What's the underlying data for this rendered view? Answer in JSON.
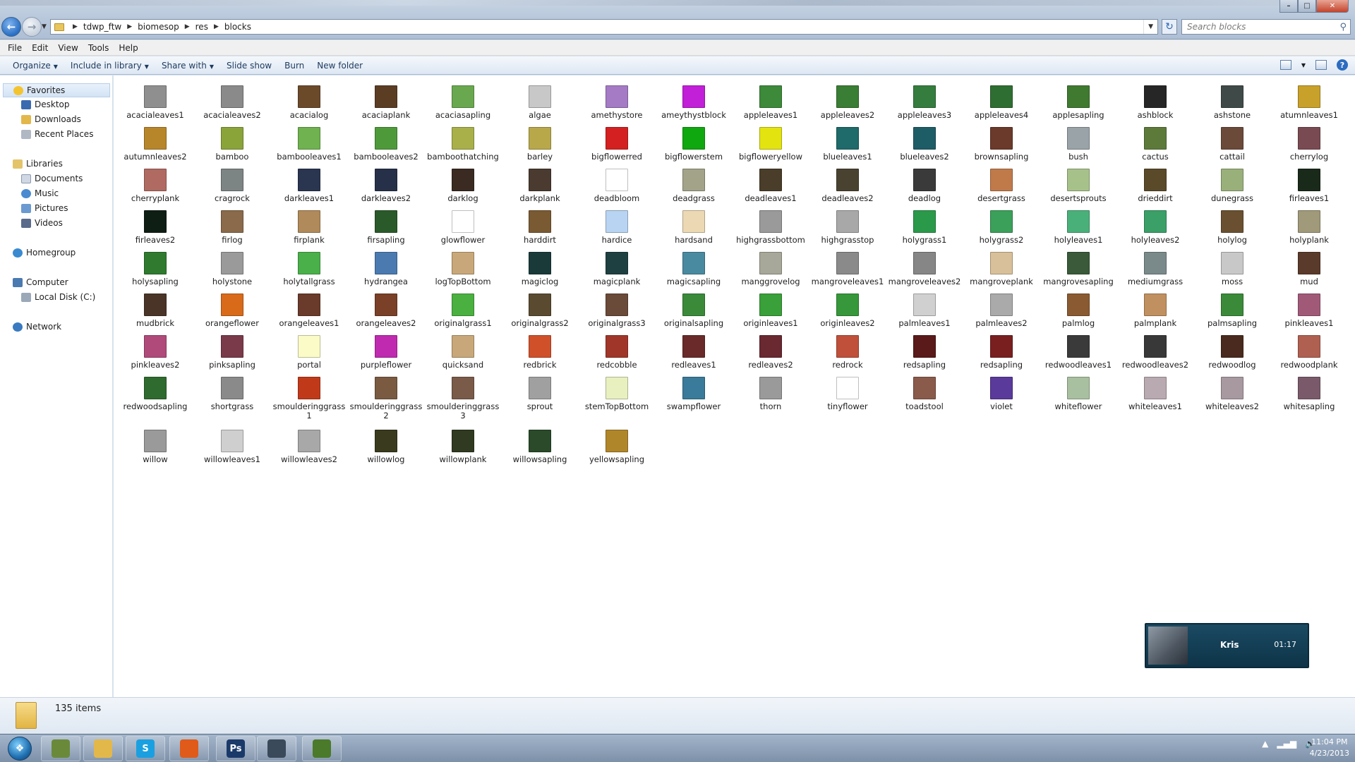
{
  "window": {
    "breadcrumb": [
      "tdwp_ftw",
      "biomesop",
      "res",
      "blocks"
    ],
    "search_placeholder": "Search blocks"
  },
  "menu": [
    "File",
    "Edit",
    "View",
    "Tools",
    "Help"
  ],
  "commands": {
    "organize": "Organize",
    "include": "Include in library",
    "share": "Share with",
    "slideshow": "Slide show",
    "burn": "Burn",
    "newfolder": "New folder"
  },
  "nav": {
    "favorites": "Favorites",
    "desktop": "Desktop",
    "downloads": "Downloads",
    "recent": "Recent Places",
    "libraries": "Libraries",
    "documents": "Documents",
    "music": "Music",
    "pictures": "Pictures",
    "videos": "Videos",
    "homegroup": "Homegroup",
    "computer": "Computer",
    "localdisk": "Local Disk (C:)",
    "network": "Network"
  },
  "files": [
    {
      "name": "acacialeaves1",
      "color": "#8f8f8f"
    },
    {
      "name": "acacialeaves2",
      "color": "#8a8a8a"
    },
    {
      "name": "acacialog",
      "color": "#6b4a2a"
    },
    {
      "name": "acaciaplank",
      "color": "#5b3d24"
    },
    {
      "name": "acaciasapling",
      "color": "#6aa84f"
    },
    {
      "name": "algae",
      "color": "#c8c8c8"
    },
    {
      "name": "amethystore",
      "color": "#a47bc4"
    },
    {
      "name": "ameythystblock",
      "color": "#c21fd8"
    },
    {
      "name": "appleleaves1",
      "color": "#3d8a3a"
    },
    {
      "name": "appleleaves2",
      "color": "#3a7d34"
    },
    {
      "name": "appleleaves3",
      "color": "#357d3e"
    },
    {
      "name": "appleleaves4",
      "color": "#2f6e32"
    },
    {
      "name": "applesapling",
      "color": "#3f7a30"
    },
    {
      "name": "ashblock",
      "color": "#262626"
    },
    {
      "name": "ashstone",
      "color": "#3f4a48"
    },
    {
      "name": "atumnleaves1",
      "color": "#c8a12a"
    },
    {
      "name": "autumnleaves2",
      "color": "#b8862a"
    },
    {
      "name": "bamboo",
      "color": "#8aa43a"
    },
    {
      "name": "bambooleaves1",
      "color": "#6fb24f"
    },
    {
      "name": "bambooleaves2",
      "color": "#4e9a3a"
    },
    {
      "name": "bamboothatching",
      "color": "#a9b04a"
    },
    {
      "name": "barley",
      "color": "#b9a84a"
    },
    {
      "name": "bigflowerred",
      "color": "#d42020"
    },
    {
      "name": "bigflowerstem",
      "color": "#0fa80f"
    },
    {
      "name": "bigfloweryellow",
      "color": "#e3e310"
    },
    {
      "name": "blueleaves1",
      "color": "#1f6a6a"
    },
    {
      "name": "blueleaves2",
      "color": "#1e5d66"
    },
    {
      "name": "brownsapling",
      "color": "#6b3a2a"
    },
    {
      "name": "bush",
      "color": "#9aa3a8"
    },
    {
      "name": "cactus",
      "color": "#5d7a3a"
    },
    {
      "name": "cattail",
      "color": "#6b4a3a"
    },
    {
      "name": "cherrylog",
      "color": "#7a4a52"
    },
    {
      "name": "cherryplank",
      "color": "#b06a62"
    },
    {
      "name": "cragrock",
      "color": "#7c8584"
    },
    {
      "name": "darkleaves1",
      "color": "#2a3550"
    },
    {
      "name": "darkleaves2",
      "color": "#263048"
    },
    {
      "name": "darklog",
      "color": "#3a2a22"
    },
    {
      "name": "darkplank",
      "color": "#4a3a30"
    },
    {
      "name": "deadbloom",
      "color": "#ffffff"
    },
    {
      "name": "deadgrass",
      "color": "#a3a38a"
    },
    {
      "name": "deadleaves1",
      "color": "#4a3e2a"
    },
    {
      "name": "deadleaves2",
      "color": "#4a4230"
    },
    {
      "name": "deadlog",
      "color": "#3a3a3a"
    },
    {
      "name": "desertgrass",
      "color": "#c07a4a"
    },
    {
      "name": "desertsprouts",
      "color": "#a6c28a"
    },
    {
      "name": "drieddirt",
      "color": "#5a4a2a"
    },
    {
      "name": "dunegrass",
      "color": "#9ab07a"
    },
    {
      "name": "firleaves1",
      "color": "#1a2a1a"
    },
    {
      "name": "firleaves2",
      "color": "#0f1e14"
    },
    {
      "name": "firlog",
      "color": "#8a6a4a"
    },
    {
      "name": "firplank",
      "color": "#b08a5a"
    },
    {
      "name": "firsapling",
      "color": "#2a5a2a"
    },
    {
      "name": "glowflower",
      "color": "#ffffff"
    },
    {
      "name": "harddirt",
      "color": "#7a5a32"
    },
    {
      "name": "hardice",
      "color": "#b8d4f2"
    },
    {
      "name": "hardsand",
      "color": "#ecd9b4"
    },
    {
      "name": "highgrassbottom",
      "color": "#9a9a9a"
    },
    {
      "name": "highgrasstop",
      "color": "#a8a8a8"
    },
    {
      "name": "holygrass1",
      "color": "#2a9a4a"
    },
    {
      "name": "holygrass2",
      "color": "#3aa05a"
    },
    {
      "name": "holyleaves1",
      "color": "#4ab07a"
    },
    {
      "name": "holyleaves2",
      "color": "#3aa068"
    },
    {
      "name": "holylog",
      "color": "#6a5030"
    },
    {
      "name": "holyplank",
      "color": "#a09a7a"
    },
    {
      "name": "holysapling",
      "color": "#2f7a2f"
    },
    {
      "name": "holystone",
      "color": "#9a9a9a"
    },
    {
      "name": "holytallgrass",
      "color": "#4ab04a"
    },
    {
      "name": "hydrangea",
      "color": "#4a7ab0"
    },
    {
      "name": "logTopBottom",
      "color": "#c8a87a"
    },
    {
      "name": "magiclog",
      "color": "#1a3a3a"
    },
    {
      "name": "magicplank",
      "color": "#1f4040"
    },
    {
      "name": "magicsapling",
      "color": "#4a8aa0"
    },
    {
      "name": "manggrovelog",
      "color": "#a8a89a"
    },
    {
      "name": "mangroveleaves1",
      "color": "#8a8a8a"
    },
    {
      "name": "mangroveleaves2",
      "color": "#868686"
    },
    {
      "name": "mangroveplank",
      "color": "#d8c09a"
    },
    {
      "name": "mangrovesapling",
      "color": "#3a5a3a"
    },
    {
      "name": "mediumgrass",
      "color": "#7a8a8a"
    },
    {
      "name": "moss",
      "color": "#c8c8c8"
    },
    {
      "name": "mud",
      "color": "#5a3a2a"
    },
    {
      "name": "mudbrick",
      "color": "#4a3428"
    },
    {
      "name": "orangeflower",
      "color": "#d86a1a"
    },
    {
      "name": "orangeleaves1",
      "color": "#6a3a2a"
    },
    {
      "name": "orangeleaves2",
      "color": "#7a4028"
    },
    {
      "name": "originalgrass1",
      "color": "#4ab040"
    },
    {
      "name": "originalgrass2",
      "color": "#5a4a30"
    },
    {
      "name": "originalgrass3",
      "color": "#6a4a38"
    },
    {
      "name": "originalsapling",
      "color": "#3a8a3a"
    },
    {
      "name": "originleaves1",
      "color": "#3aa03a"
    },
    {
      "name": "originleaves2",
      "color": "#36983a"
    },
    {
      "name": "palmleaves1",
      "color": "#d0d0d0"
    },
    {
      "name": "palmleaves2",
      "color": "#aaaaaa"
    },
    {
      "name": "palmlog",
      "color": "#8a5a32"
    },
    {
      "name": "palmplank",
      "color": "#c09060"
    },
    {
      "name": "palmsapling",
      "color": "#3a8a3a"
    },
    {
      "name": "pinkleaves1",
      "color": "#a05a78"
    },
    {
      "name": "pinkleaves2",
      "color": "#b04a7a"
    },
    {
      "name": "pinksapling",
      "color": "#7a3a4a"
    },
    {
      "name": "portal",
      "color": "#fbfbc8"
    },
    {
      "name": "purpleflower",
      "color": "#c02ab0"
    },
    {
      "name": "quicksand",
      "color": "#c8a87a"
    },
    {
      "name": "redbrick",
      "color": "#d0502a"
    },
    {
      "name": "redcobble",
      "color": "#a0362a"
    },
    {
      "name": "redleaves1",
      "color": "#6a2a2a"
    },
    {
      "name": "redleaves2",
      "color": "#6a2830"
    },
    {
      "name": "redrock",
      "color": "#c0503a"
    },
    {
      "name": "redsapling",
      "color": "#5a1a1a"
    },
    {
      "name": "redsapling",
      "color": "#7a1f1f"
    },
    {
      "name": "redwoodleaves1",
      "color": "#3a3a3a"
    },
    {
      "name": "redwoodleaves2",
      "color": "#383838"
    },
    {
      "name": "redwoodlog",
      "color": "#4a2a1e"
    },
    {
      "name": "redwoodplank",
      "color": "#b06050"
    },
    {
      "name": "redwoodsapling",
      "color": "#2f6a2f"
    },
    {
      "name": "shortgrass",
      "color": "#8a8a8a"
    },
    {
      "name": "smoulderinggrass1",
      "color": "#c03a1a"
    },
    {
      "name": "smoulderinggrass2",
      "color": "#7a5a40"
    },
    {
      "name": "smoulderinggrass3",
      "color": "#7a5a48"
    },
    {
      "name": "sprout",
      "color": "#a0a0a0"
    },
    {
      "name": "stemTopBottom",
      "color": "#e8f0c0"
    },
    {
      "name": "swampflower",
      "color": "#3a7a9a"
    },
    {
      "name": "thorn",
      "color": "#9a9a9a"
    },
    {
      "name": "tinyflower",
      "color": "#ffffff"
    },
    {
      "name": "toadstool",
      "color": "#8a5a4a"
    },
    {
      "name": "violet",
      "color": "#5a3a9a"
    },
    {
      "name": "whiteflower",
      "color": "#a8c0a0"
    },
    {
      "name": "whiteleaves1",
      "color": "#b8aab0"
    },
    {
      "name": "whiteleaves2",
      "color": "#a898a0"
    },
    {
      "name": "whitesapling",
      "color": "#7a5a6a"
    },
    {
      "name": "willow",
      "color": "#9a9a9a"
    },
    {
      "name": "willowleaves1",
      "color": "#cfcfcf"
    },
    {
      "name": "willowleaves2",
      "color": "#a8a8a8"
    },
    {
      "name": "willowlog",
      "color": "#3a3a1e"
    },
    {
      "name": "willowplank",
      "color": "#2f3a20"
    },
    {
      "name": "willowsapling",
      "color": "#2a4a2a"
    },
    {
      "name": "yellowsapling",
      "color": "#b0862a"
    }
  ],
  "status": {
    "count": "135 items"
  },
  "call": {
    "name": "Kris",
    "time": "01:17"
  },
  "taskbar": {
    "apps": [
      {
        "icon": "minecraft-texture-icon",
        "color": "#6a8a3a",
        "label": ""
      },
      {
        "icon": "folder-icon",
        "color": "#e3b84a",
        "label": ""
      },
      {
        "icon": "skype-icon",
        "color": "#1aa0e0",
        "label": "S"
      },
      {
        "icon": "firefox-icon",
        "color": "#e05a1a",
        "label": ""
      },
      {
        "icon": "photoshop-icon",
        "color": "#1a3a6a",
        "label": "Ps"
      },
      {
        "icon": "steam-icon",
        "color": "#3a4a5a",
        "label": ""
      },
      {
        "icon": "minecraft-icon",
        "color": "#4a7a2a",
        "label": ""
      }
    ],
    "time": "11:04 PM",
    "date": "4/23/2013"
  }
}
